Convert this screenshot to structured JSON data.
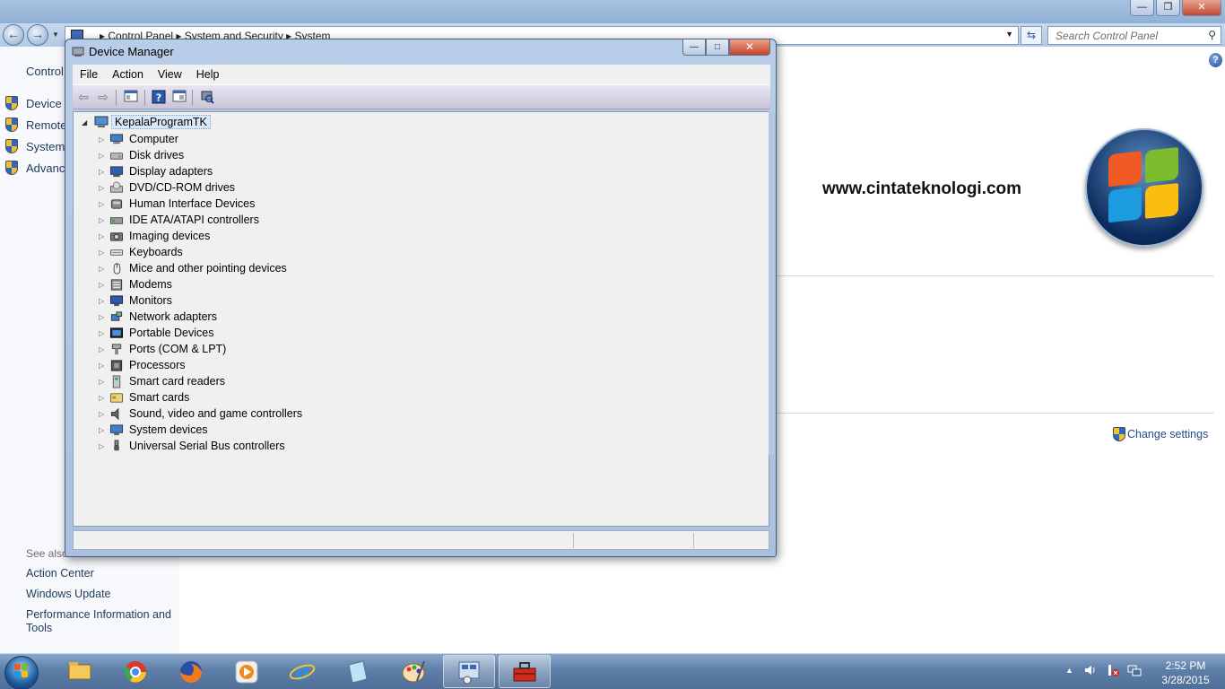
{
  "control_panel": {
    "address": {
      "parts": [
        "Control Panel",
        "System and Security",
        "System"
      ]
    },
    "search": {
      "placeholder": "Search Control Panel"
    },
    "sidebar": {
      "title": "Control",
      "tasks": [
        {
          "label": "Device M",
          "icon": "shield-icon"
        },
        {
          "label": "Remote",
          "icon": "shield-icon"
        },
        {
          "label": "System",
          "icon": "shield-icon"
        },
        {
          "label": "Advanc",
          "icon": "shield-icon"
        }
      ],
      "see_also_label": "See also",
      "see_also": [
        "Action Center",
        "Windows Update",
        "Performance Information and Tools"
      ]
    },
    "watermark": "www.cintateknologi.com",
    "change_settings": "Change settings"
  },
  "device_manager": {
    "title": "Device Manager",
    "menu": [
      "File",
      "Action",
      "View",
      "Help"
    ],
    "toolbar": [
      "back-icon",
      "forward-icon",
      "show-hide-tree-icon",
      "help-icon",
      "properties-icon",
      "scan-hardware-icon"
    ],
    "root": "KepalaProgramTK",
    "categories": [
      {
        "label": "Computer",
        "icon": "computer-icon"
      },
      {
        "label": "Disk drives",
        "icon": "disk-drive-icon"
      },
      {
        "label": "Display adapters",
        "icon": "display-adapter-icon"
      },
      {
        "label": "DVD/CD-ROM drives",
        "icon": "dvd-drive-icon"
      },
      {
        "label": "Human Interface Devices",
        "icon": "hid-icon"
      },
      {
        "label": "IDE ATA/ATAPI controllers",
        "icon": "ide-controller-icon"
      },
      {
        "label": "Imaging devices",
        "icon": "camera-icon"
      },
      {
        "label": "Keyboards",
        "icon": "keyboard-icon"
      },
      {
        "label": "Mice and other pointing devices",
        "icon": "mouse-icon"
      },
      {
        "label": "Modems",
        "icon": "modem-icon"
      },
      {
        "label": "Monitors",
        "icon": "monitor-icon"
      },
      {
        "label": "Network adapters",
        "icon": "network-adapter-icon"
      },
      {
        "label": "Portable Devices",
        "icon": "portable-device-icon"
      },
      {
        "label": "Ports (COM & LPT)",
        "icon": "port-icon"
      },
      {
        "label": "Processors",
        "icon": "processor-icon"
      },
      {
        "label": "Smart card readers",
        "icon": "smart-card-reader-icon"
      },
      {
        "label": "Smart cards",
        "icon": "smart-card-icon"
      },
      {
        "label": "Sound, video and game controllers",
        "icon": "speaker-icon"
      },
      {
        "label": "System devices",
        "icon": "system-device-icon"
      },
      {
        "label": "Universal Serial Bus controllers",
        "icon": "usb-icon"
      }
    ]
  },
  "taskbar": {
    "apps": [
      {
        "name": "file-explorer-icon",
        "active": false
      },
      {
        "name": "chrome-icon",
        "active": false
      },
      {
        "name": "firefox-icon",
        "active": false
      },
      {
        "name": "media-player-icon",
        "active": false
      },
      {
        "name": "internet-explorer-icon",
        "active": false
      },
      {
        "name": "notepad-icon",
        "active": false
      },
      {
        "name": "paint-icon",
        "active": false
      },
      {
        "name": "control-panel-icon",
        "active": true
      },
      {
        "name": "toolbox-icon",
        "active": true
      }
    ],
    "clock": {
      "time": "2:52 PM",
      "date": "3/28/2015"
    }
  },
  "colors": {
    "link": "#1e395b",
    "titlebar": "#a9c0e0",
    "close": "#c5432a",
    "taskbar": "#5d7ea8"
  }
}
